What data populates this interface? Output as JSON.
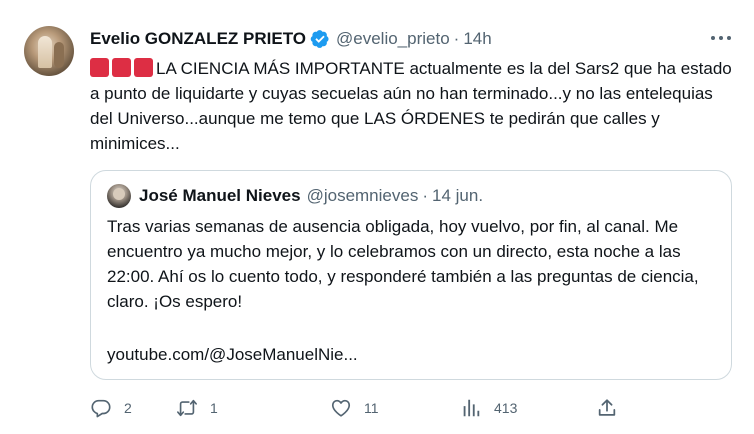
{
  "tweet": {
    "author_name": "Evelio GONZALEZ PRIETO",
    "handle": "@evelio_prieto",
    "separator": "·",
    "time": "14h",
    "avatar_icon": "profile-photo",
    "verified_icon": "verified-badge-icon",
    "verified_color": "#1d9bf0",
    "emoji_color": "#dd2e44",
    "text": "LA CIENCIA MÁS IMPORTANTE actualmente es la del Sars2 que ha estado a punto de liquidarte y cuyas secuelas aún no han terminado...y no las entelequias del Universo...aunque me temo que LAS ÓRDENES te pedirán que calles y minimices..."
  },
  "quoted": {
    "author_name": "José Manuel Nieves",
    "handle": "@josemnieves",
    "separator": "·",
    "date": "14 jun.",
    "text": "Tras varias semanas de ausencia obligada, hoy vuelvo, por fin, al canal. Me encuentro ya mucho mejor, y lo celebramos con un directo, esta noche a las 22:00. Ahí os lo cuento todo, y responderé también a las preguntas de ciencia, claro. ¡Os espero!",
    "link": "youtube.com/@JoseManuelNie..."
  },
  "actions": {
    "replies": "2",
    "retweets": "1",
    "likes": "11",
    "views": "413"
  },
  "colors": {
    "text": "#0f1419",
    "muted": "#536471",
    "border": "#cfd9de"
  }
}
